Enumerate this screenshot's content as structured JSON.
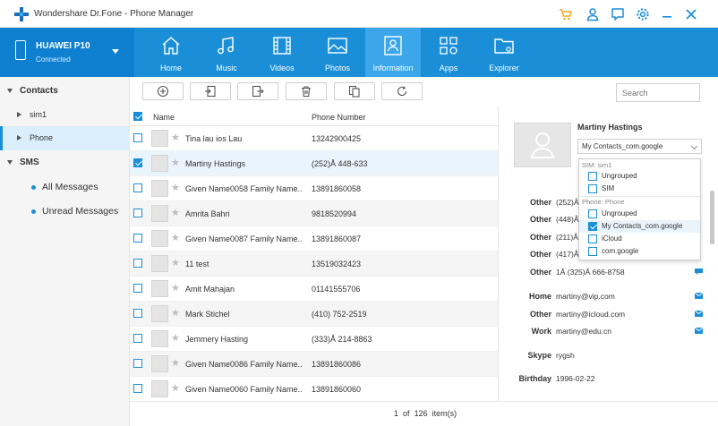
{
  "titlebar": {
    "app_title": "Wondershare Dr.Fone - Phone Manager"
  },
  "icons": {
    "logo": "plus-logo-icon",
    "cart": "cart-icon",
    "user": "user-icon",
    "feedback": "feedback-icon",
    "settings": "gear-icon",
    "minimize": "minimize-icon",
    "close": "close-icon"
  },
  "colors": {
    "accent": "#1a8fd8",
    "nav_active": "#3ba7ea",
    "cart": "#f5a623"
  },
  "device": {
    "name": "HUAWEI P10",
    "status": "Connected"
  },
  "tabs": [
    {
      "label": "Home",
      "icon": "home-icon"
    },
    {
      "label": "Music",
      "icon": "music-icon"
    },
    {
      "label": "Videos",
      "icon": "video-icon"
    },
    {
      "label": "Photos",
      "icon": "photo-icon"
    },
    {
      "label": "Information",
      "icon": "contact-card-icon",
      "active": true
    },
    {
      "label": "Apps",
      "icon": "apps-icon"
    },
    {
      "label": "Explorer",
      "icon": "folder-icon"
    }
  ],
  "sidebar": {
    "contacts": "Contacts",
    "sim1": "sim1",
    "phone": "Phone",
    "sms": "SMS",
    "all_messages": "All Messages",
    "unread_messages": "Unread Messages"
  },
  "toolbar": {
    "search_placeholder": "Search"
  },
  "list": {
    "header_name": "Name",
    "header_phone": "Phone Number",
    "rows": [
      {
        "name": "Tina lau ios  Lau",
        "phone": "13242900425"
      },
      {
        "name": "Martiny  Hastings",
        "phone": "(252)Å 448-633"
      },
      {
        "name": "Given Name0058  Family Name...",
        "phone": "13891860058"
      },
      {
        "name": "Amrita Bahri",
        "phone": "9818520994"
      },
      {
        "name": "Given Name0087  Family Name...",
        "phone": "13891860087"
      },
      {
        "name": "11  test",
        "phone": "13519032423"
      },
      {
        "name": "Amit Mahajan",
        "phone": "01141555706"
      },
      {
        "name": "Mark Stichel",
        "phone": "(410) 752-2519"
      },
      {
        "name": "Jemmery  Hasting",
        "phone": "(333)Å 214-8863"
      },
      {
        "name": "Given Name0086  Family Name...",
        "phone": "13891860086"
      },
      {
        "name": "Given Name0060  Family Name...",
        "phone": "13891860060"
      }
    ]
  },
  "footer": {
    "page": "1",
    "of": "of",
    "total": "126",
    "unit": "item(s)"
  },
  "detail": {
    "name": "Martiny  Hastings",
    "group_selected": "My Contacts_com.google",
    "dropdown": {
      "sim_head": "SIM: sim1",
      "sim_items": [
        "Ungrouped",
        "SIM"
      ],
      "phone_head": "Phone: Phone",
      "phone_items": [
        "Ungrouped",
        "My Contacts_com.google",
        "iCloud",
        "com.google"
      ]
    },
    "fields": [
      {
        "label": "Other",
        "value": "(252)Å"
      },
      {
        "label": "Other",
        "value": "(448)Å"
      },
      {
        "label": "Other",
        "value": "(211)Å"
      },
      {
        "label": "Other",
        "value": "(417)Å"
      },
      {
        "label": "Other",
        "value": "1Å (325)Å 666-8758"
      },
      {
        "label": "Home",
        "value": "martiny@vip.com"
      },
      {
        "label": "Other",
        "value": "martiny@icloud.com"
      },
      {
        "label": "Work",
        "value": "martiny@edu.cn"
      },
      {
        "label": "Skype",
        "value": "rygsh"
      },
      {
        "label": "Birthday",
        "value": "1996-02-22"
      }
    ]
  }
}
